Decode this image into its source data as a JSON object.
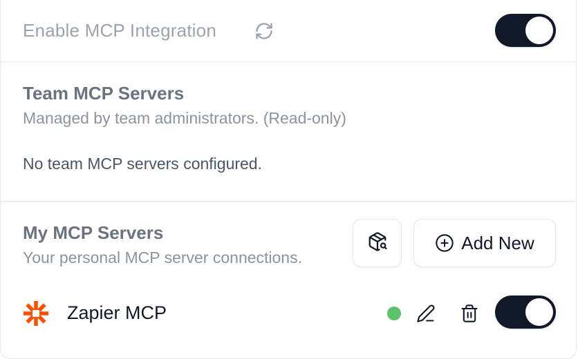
{
  "header": {
    "title": "Enable MCP Integration",
    "refresh_icon": "refresh-icon",
    "enabled": true
  },
  "team_servers": {
    "title": "Team MCP Servers",
    "subtitle": "Managed by team administrators. (Read-only)",
    "empty_message": "No team MCP servers configured."
  },
  "my_servers": {
    "title": "My MCP Servers",
    "subtitle": "Your personal MCP server connections.",
    "browse_icon": "package-search-icon",
    "add_button_label": "Add New",
    "add_icon": "plus-circle-icon",
    "servers": [
      {
        "name": "Zapier MCP",
        "logo": "zapier-logo-icon",
        "status": "connected",
        "status_color": "#5ec26a",
        "enabled": true
      }
    ]
  },
  "colors": {
    "toggle_on": "#111827",
    "zapier_orange": "#ff4f00",
    "muted_text": "#9ca3af"
  }
}
